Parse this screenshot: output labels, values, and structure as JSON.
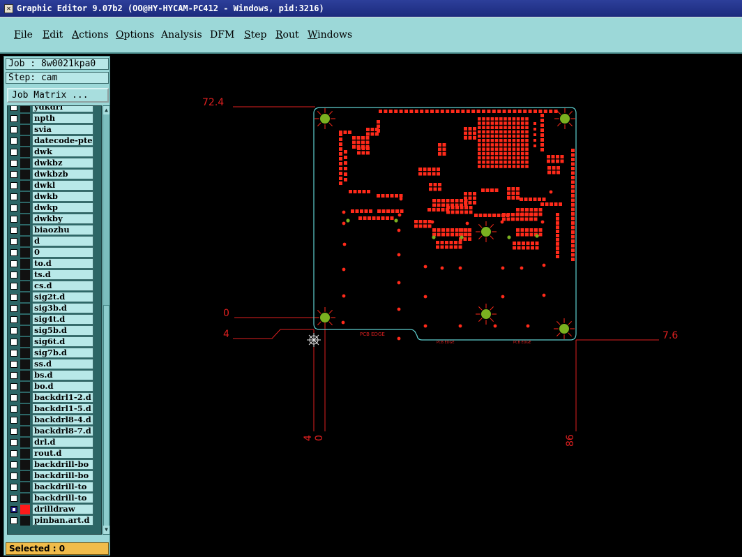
{
  "window": {
    "title": "Graphic Editor 9.07b2 (OO@HY-HYCAM-PC412 - Windows, pid:3216)"
  },
  "menu": [
    {
      "label": "File",
      "ul": "F",
      "rest": "ile"
    },
    {
      "label": "Edit",
      "ul": "E",
      "rest": "dit"
    },
    {
      "label": "Actions",
      "ul": "A",
      "rest": "ctions"
    },
    {
      "label": "Options",
      "ul": "O",
      "rest": "ptions"
    },
    {
      "label": "Analysis",
      "ul": "",
      "rest": "Analysis"
    },
    {
      "label": "DFM",
      "ul": "",
      "rest": "DFM"
    },
    {
      "label": "Step",
      "ul": "S",
      "rest": "tep"
    },
    {
      "label": "Rout",
      "ul": "R",
      "rest": "out"
    },
    {
      "label": "Windows",
      "ul": "W",
      "rest": "indows"
    }
  ],
  "panel": {
    "job": "Job : 8w0021kpa0",
    "step": "Step: cam",
    "job_matrix": "Job Matrix ...",
    "selected": "Selected : 0"
  },
  "layers": [
    {
      "name": "ydkdrl",
      "checked": false,
      "color": ""
    },
    {
      "name": "npth",
      "checked": false,
      "color": ""
    },
    {
      "name": "svia",
      "checked": false,
      "color": ""
    },
    {
      "name": "datecode-pte",
      "checked": false,
      "color": ""
    },
    {
      "name": "dwk",
      "checked": false,
      "color": ""
    },
    {
      "name": "dwkbz",
      "checked": false,
      "color": ""
    },
    {
      "name": "dwkbzb",
      "checked": false,
      "color": ""
    },
    {
      "name": "dwkl",
      "checked": false,
      "color": ""
    },
    {
      "name": "dwkb",
      "checked": false,
      "color": ""
    },
    {
      "name": "dwkp",
      "checked": false,
      "color": ""
    },
    {
      "name": "dwkby",
      "checked": false,
      "color": ""
    },
    {
      "name": "biaozhu",
      "checked": false,
      "color": ""
    },
    {
      "name": "d",
      "checked": false,
      "color": ""
    },
    {
      "name": "0",
      "checked": false,
      "color": ""
    },
    {
      "name": "to.d",
      "checked": false,
      "color": ""
    },
    {
      "name": "ts.d",
      "checked": false,
      "color": ""
    },
    {
      "name": "cs.d",
      "checked": false,
      "color": ""
    },
    {
      "name": "sig2t.d",
      "checked": false,
      "color": ""
    },
    {
      "name": "sig3b.d",
      "checked": false,
      "color": ""
    },
    {
      "name": "sig4t.d",
      "checked": false,
      "color": ""
    },
    {
      "name": "sig5b.d",
      "checked": false,
      "color": ""
    },
    {
      "name": "sig6t.d",
      "checked": false,
      "color": ""
    },
    {
      "name": "sig7b.d",
      "checked": false,
      "color": ""
    },
    {
      "name": "ss.d",
      "checked": false,
      "color": ""
    },
    {
      "name": "bs.d",
      "checked": false,
      "color": ""
    },
    {
      "name": "bo.d",
      "checked": false,
      "color": ""
    },
    {
      "name": "backdrl1-2.d",
      "checked": false,
      "color": ""
    },
    {
      "name": "backdrl1-5.d",
      "checked": false,
      "color": ""
    },
    {
      "name": "backdrl8-4.d",
      "checked": false,
      "color": ""
    },
    {
      "name": "backdrl8-7.d",
      "checked": false,
      "color": ""
    },
    {
      "name": "drl.d",
      "checked": false,
      "color": ""
    },
    {
      "name": "rout.d",
      "checked": false,
      "color": ""
    },
    {
      "name": "backdrill-bo",
      "checked": false,
      "color": ""
    },
    {
      "name": "backdrill-bo",
      "checked": false,
      "color": ""
    },
    {
      "name": "backdrill-to",
      "checked": false,
      "color": ""
    },
    {
      "name": "backdrill-to",
      "checked": false,
      "color": ""
    },
    {
      "name": "drilldraw",
      "checked": true,
      "color": "#ff1a1a"
    },
    {
      "name": "pinban.art.d",
      "checked": false,
      "color": ""
    }
  ],
  "canvas": {
    "colors": {
      "profile": "#5fd0d0",
      "pads": "#ff2a1a",
      "ruler": "#e02020",
      "green": "#7ab020"
    },
    "labels": {
      "top_y": "72.4",
      "zero_y": "0",
      "four_y": "4",
      "right_x": "7.6",
      "bottom_4": "4",
      "bottom_0": "0",
      "bottom_86": "86",
      "pcb_edge_1": "PCB EDGE",
      "pcb_edge_2": "PCB EDGE",
      "pcb_edge_3": "PCB EDGE"
    }
  }
}
